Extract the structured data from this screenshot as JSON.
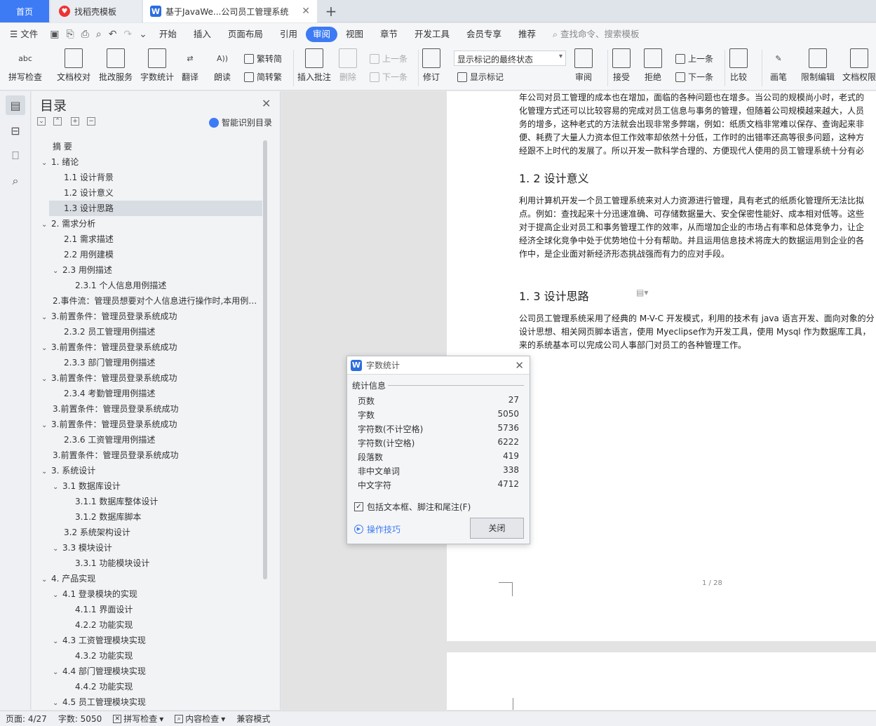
{
  "tabs": {
    "home": "首页",
    "template": "找稻壳模板",
    "document": "基于JavaWe...公司员工管理系统",
    "add": "+"
  },
  "menu": {
    "file": "文件",
    "items": [
      "开始",
      "插入",
      "页面布局",
      "引用",
      "审阅",
      "视图",
      "章节",
      "开发工具",
      "会员专享",
      "推荐"
    ],
    "active": "审阅",
    "search": "查找命令、搜索模板"
  },
  "ribbon": {
    "spell_check": "拼写检查",
    "spell_icon": "abc",
    "doc_proof": "文档校对",
    "batch_service": "批改服务",
    "word_count": "字数统计",
    "translate": "翻译",
    "read_aloud": "朗读",
    "trad": "繁转简",
    "simp": "简转繁",
    "insert_comment": "插入批注",
    "delete": "删除",
    "prev_comment": "上一条",
    "next_comment": "下一条",
    "revise": "修订",
    "markup_state": "显示标记的最终状态",
    "show_markup": "显示标记",
    "review": "审阅",
    "accept": "接受",
    "reject": "拒绝",
    "prev_change": "上一条",
    "next_change": "下一条",
    "compare": "比较",
    "ink": "画笔",
    "restrict": "限制编辑",
    "doc_perm": "文档权限"
  },
  "toc": {
    "title": "目录",
    "smart": "智能识别目录",
    "items": [
      {
        "label": "摘  要",
        "level": 1,
        "chev": ""
      },
      {
        "label": "1. 绪论",
        "level": 1,
        "chev": "⌄"
      },
      {
        "label": "1.1 设计背景",
        "level": 2,
        "chev": ""
      },
      {
        "label": "1.2 设计意义",
        "level": 2,
        "chev": ""
      },
      {
        "label": "1.3 设计思路",
        "level": 2,
        "chev": "",
        "selected": true
      },
      {
        "label": "2. 需求分析",
        "level": 1,
        "chev": "⌄"
      },
      {
        "label": "2.1 需求描述",
        "level": 2,
        "chev": ""
      },
      {
        "label": "2.2 用例建模",
        "level": 2,
        "chev": ""
      },
      {
        "label": "2.3 用例描述",
        "level": 2,
        "chev": "⌄"
      },
      {
        "label": "2.3.1 个人信息用例描述",
        "level": 3,
        "chev": ""
      },
      {
        "label": "2.事件流：管理员想要对个人信息进行操作时,本用例开始执行",
        "level": 1,
        "chev": ""
      },
      {
        "label": "3.前置条件：管理员登录系统成功",
        "level": 1,
        "chev": "⌄"
      },
      {
        "label": "2.3.2 员工管理用例描述",
        "level": 2,
        "chev": ""
      },
      {
        "label": "3.前置条件：管理员登录系统成功",
        "level": 1,
        "chev": "⌄"
      },
      {
        "label": "2.3.3 部门管理用例描述",
        "level": 2,
        "chev": ""
      },
      {
        "label": "3.前置条件：管理员登录系统成功",
        "level": 1,
        "chev": "⌄"
      },
      {
        "label": "2.3.4 考勤管理用例描述",
        "level": 2,
        "chev": ""
      },
      {
        "label": "3.前置条件：管理员登录系统成功",
        "level": 1,
        "chev": ""
      },
      {
        "label": "3.前置条件：管理员登录系统成功",
        "level": 1,
        "chev": "⌄"
      },
      {
        "label": "2.3.6 工资管理用例描述",
        "level": 2,
        "chev": ""
      },
      {
        "label": "3.前置条件：管理员登录系统成功",
        "level": 1,
        "chev": ""
      },
      {
        "label": "3. 系统设计",
        "level": 1,
        "chev": "⌄"
      },
      {
        "label": "3.1 数据库设计",
        "level": 2,
        "chev": "⌄"
      },
      {
        "label": "3.1.1 数据库整体设计",
        "level": 3,
        "chev": ""
      },
      {
        "label": "3.1.2 数据库脚本",
        "level": 3,
        "chev": ""
      },
      {
        "label": "3.2 系统架构设计",
        "level": 2,
        "chev": ""
      },
      {
        "label": "3.3 模块设计",
        "level": 2,
        "chev": "⌄"
      },
      {
        "label": "3.3.1 功能模块设计",
        "level": 3,
        "chev": ""
      },
      {
        "label": "4. 产品实现",
        "level": 1,
        "chev": "⌄"
      },
      {
        "label": "4.1 登录模块的实现",
        "level": 2,
        "chev": "⌄"
      },
      {
        "label": "4.1.1 界面设计",
        "level": 3,
        "chev": ""
      },
      {
        "label": "4.2.2 功能实现",
        "level": 3,
        "chev": ""
      },
      {
        "label": "4.3 工资管理模块实现",
        "level": 2,
        "chev": "⌄"
      },
      {
        "label": "4.3.2 功能实现",
        "level": 3,
        "chev": ""
      },
      {
        "label": "4.4 部门管理模块实现",
        "level": 2,
        "chev": "⌄"
      },
      {
        "label": "4.4.2 功能实现",
        "level": 3,
        "chev": ""
      },
      {
        "label": "4.5 员工管理模块实现",
        "level": 2,
        "chev": "⌄"
      }
    ]
  },
  "document": {
    "para1": [
      "年公司对员工管理的成本也在增加，面临的各种问题也在增多。当公司的规模尚小时，老式的",
      "化管理方式还可以比较容易的完成对员工信息与事务的管理，但随着公司规模越来越大，人员",
      "务的增多，这种老式的方法就会出现非常多弊端，例如：纸质文档非常难以保存、查询起来非",
      "便、耗费了大量人力资本但工作效率却依然十分低，工作时的出错率还高等很多问题，这种方",
      "经跟不上时代的发展了。所以开发一款科学合理的、方便现代人使用的员工管理系统十分有必"
    ],
    "heading2": "1. 2 设计意义",
    "para2": [
      "利用计算机开发一个员工管理系统来对人力资源进行管理，具有老式的纸质化管理所无法比拟",
      "点。例如：查找起来十分迅速准确、可存储数据量大、安全保密性能好、成本相对低等。这些",
      "对于提高企业对员工和事务管理工作的效率，从而增加企业的市场占有率和总体竞争力，让企",
      "经济全球化竞争中处于优势地位十分有帮助。并且运用信息技术将庞大的数据运用到企业的各",
      "作中，是企业面对新经济形态挑战强而有力的应对手段。"
    ],
    "heading3": "1. 3 设计思路",
    "para3": [
      "公司员工管理系统采用了经典的 M-V-C 开发模式，利用的技术有 java 语言开发、面向对象的分",
      "设计思想、相关网页脚本语言，使用 Myeclipse作为开发工具，使用 Mysql 作为数据库工具，",
      "来的系统基本可以完成公司人事部门对员工的各种管理工作。"
    ],
    "page_number": "1 / 28"
  },
  "dialog": {
    "title": "字数统计",
    "section": "统计信息",
    "stats": [
      {
        "label": "页数",
        "value": "27"
      },
      {
        "label": "字数",
        "value": "5050"
      },
      {
        "label": "字符数(不计空格)",
        "value": "5736"
      },
      {
        "label": "字符数(计空格)",
        "value": "6222"
      },
      {
        "label": "段落数",
        "value": "419"
      },
      {
        "label": "非中文单词",
        "value": "338"
      },
      {
        "label": "中文字符",
        "value": "4712"
      }
    ],
    "checkbox": "包括文本框、脚注和尾注(F)",
    "tips": "操作技巧",
    "close": "关闭"
  },
  "status": {
    "page": "页面: 4/27",
    "words": "字数: 5050",
    "spell": "拼写检查",
    "content": "内容检查",
    "compat": "兼容模式"
  },
  "colors": {
    "accent": "#3d7bf5",
    "tab_active_bg": "#ffffff"
  }
}
